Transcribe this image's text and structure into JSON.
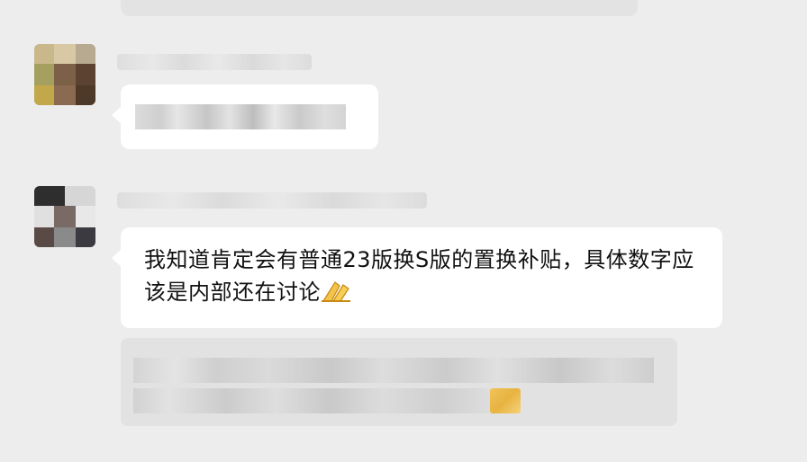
{
  "chat": {
    "messages": [
      {
        "sender": "",
        "avatar": "avatar-1",
        "text": ""
      },
      {
        "sender": "",
        "avatar": "avatar-2",
        "text": "我知道肯定会有普通23版换S版的置换补贴，具体数字应该是内部还在讨论",
        "emoji": "folded-hands-emoji"
      }
    ],
    "quoted_reply": {
      "text": ""
    }
  },
  "colors": {
    "background": "#ededed",
    "bubble": "#ffffff",
    "quote_bubble": "#e2e2e2",
    "text": "#111111"
  }
}
